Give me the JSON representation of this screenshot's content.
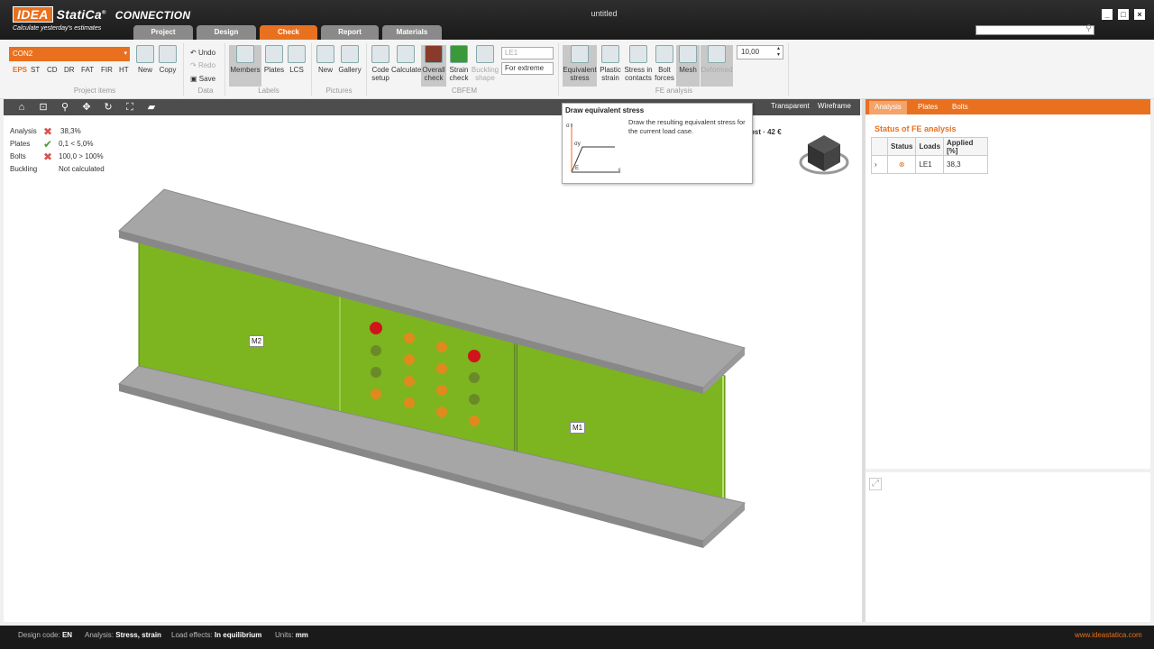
{
  "app": {
    "brand": "IDEA StatiCa",
    "product": "CONNECTION",
    "slogan": "Calculate yesterday's estimates",
    "title": "untitled"
  },
  "tabs": [
    {
      "label": "Project"
    },
    {
      "label": "Design"
    },
    {
      "label": "Check"
    },
    {
      "label": "Report"
    },
    {
      "label": "Materials"
    }
  ],
  "window": {
    "minimize": "_",
    "maximize": "□",
    "close": "×"
  },
  "ribbon": {
    "project_items": {
      "group": "Project items",
      "selected": "CON2",
      "types": [
        "EPS",
        "ST",
        "CD",
        "DR",
        "FAT",
        "FIR",
        "HT"
      ],
      "new": "New",
      "copy": "Copy"
    },
    "data": {
      "group": "Data",
      "undo": "Undo",
      "redo": "Redo",
      "save": "Save"
    },
    "labels": {
      "group": "Labels",
      "members": "Members",
      "plates": "Plates",
      "lcs": "LCS"
    },
    "pictures": {
      "group": "Pictures",
      "new": "New",
      "gallery": "Gallery"
    },
    "cbfem": {
      "group": "CBFEM",
      "code_setup": "Code setup",
      "calculate": "Calculate",
      "overall_check": "Overall check",
      "strain_check": "Strain check",
      "buckling_shape": "Buckling shape",
      "load_case": "LE1",
      "extreme": "For extreme"
    },
    "fe": {
      "group": "FE analysis",
      "equivalent_stress": "Equivalent stress",
      "plastic_strain": "Plastic strain",
      "stress_contacts": "Stress in contacts",
      "bolt_forces": "Bolt forces",
      "mesh": "Mesh",
      "deformed": "Deformed",
      "scale": "10,00"
    }
  },
  "view_modes": [
    "Transparent",
    "Wireframe"
  ],
  "results": [
    {
      "label": "Analysis",
      "status": "fail",
      "value": "38,3%"
    },
    {
      "label": "Plates",
      "status": "ok",
      "value": "0,1 < 5,0%"
    },
    {
      "label": "Bolts",
      "status": "fail",
      "value": "100,0 > 100%"
    },
    {
      "label": "Buckling",
      "status": "none",
      "value": "Not calculated"
    }
  ],
  "cost": "42 €",
  "cost_prefix": "ost",
  "members": {
    "m1": "M1",
    "m2": "M2"
  },
  "tooltip": {
    "title": "Draw equivalent stress",
    "desc": "Draw the resulting equivalent stress for the current load case.",
    "sigma": "σ",
    "sigma_y": "σy",
    "e": "E",
    "eps": "ε"
  },
  "right_panel": {
    "tabs": [
      "Analysis",
      "Plates",
      "Bolts"
    ],
    "title": "Status of FE analysis",
    "table": {
      "headers": [
        "Status",
        "Loads",
        "Applied [%]"
      ],
      "row": {
        "load": "LE1",
        "applied": "38,3"
      }
    }
  },
  "status_bar": {
    "design_code_label": "Design code:",
    "design_code": "EN",
    "analysis_label": "Analysis:",
    "analysis": "Stress, strain",
    "load_effects_label": "Load effects:",
    "load_effects": "In equilibrium",
    "units_label": "Units:",
    "units": "mm",
    "website": "www.ideastatica.com"
  },
  "colors": {
    "accent": "#e8701e",
    "web": "#7cb51f",
    "flange": "#a6a6a6"
  }
}
